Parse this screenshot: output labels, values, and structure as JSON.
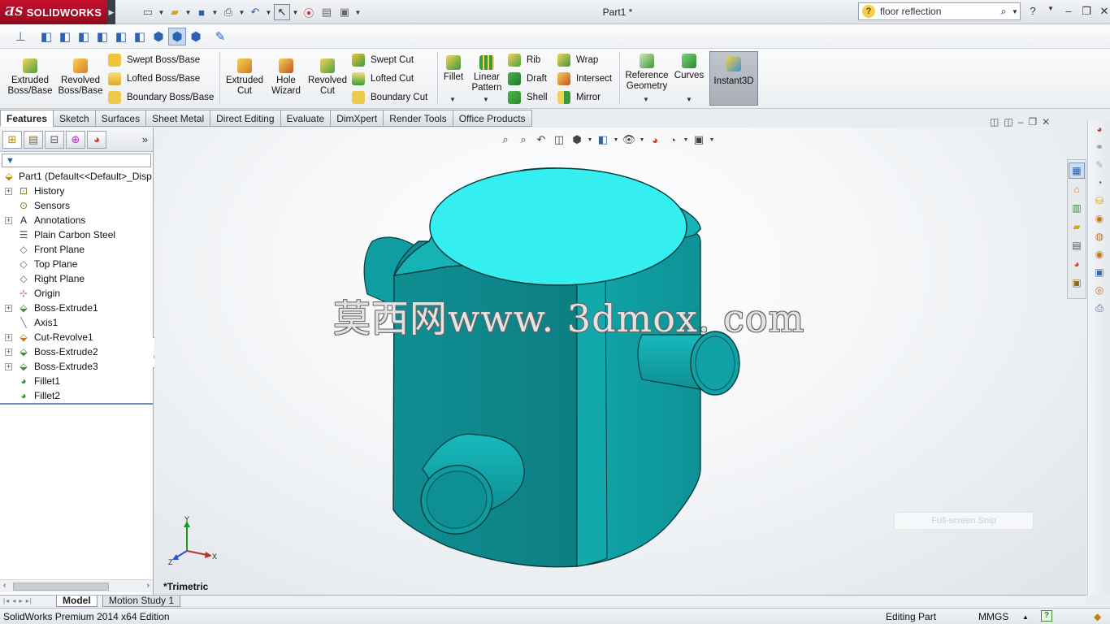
{
  "app": {
    "brand": "SOLIDWORKS",
    "document_title": "Part1 *"
  },
  "search": {
    "value": "floor reflection"
  },
  "ribbon": {
    "extruded_boss": "Extruded Boss/Base",
    "revolved_boss": "Revolved Boss/Base",
    "swept_boss": "Swept Boss/Base",
    "lofted_boss": "Lofted Boss/Base",
    "boundary_boss": "Boundary Boss/Base",
    "extruded_cut": "Extruded Cut",
    "hole_wizard": "Hole Wizard",
    "revolved_cut": "Revolved Cut",
    "swept_cut": "Swept Cut",
    "lofted_cut": "Lofted Cut",
    "boundary_cut": "Boundary Cut",
    "fillet": "Fillet",
    "linear_pattern": "Linear Pattern",
    "rib": "Rib",
    "draft": "Draft",
    "shell": "Shell",
    "wrap": "Wrap",
    "intersect": "Intersect",
    "mirror": "Mirror",
    "reference_geometry": "Reference Geometry",
    "curves": "Curves",
    "instant3d": "Instant3D"
  },
  "tabs": [
    "Features",
    "Sketch",
    "Surfaces",
    "Sheet Metal",
    "Direct Editing",
    "Evaluate",
    "DimXpert",
    "Render Tools",
    "Office Products"
  ],
  "feature_tree": {
    "root": "Part1  (Default<<Default>_Disp",
    "items": [
      {
        "label": "History",
        "icon": "history-icon",
        "expandable": true
      },
      {
        "label": "Sensors",
        "icon": "sensors-icon",
        "expandable": false
      },
      {
        "label": "Annotations",
        "icon": "annotations-icon",
        "expandable": true
      },
      {
        "label": "Plain Carbon Steel",
        "icon": "material-icon",
        "expandable": false
      },
      {
        "label": "Front Plane",
        "icon": "plane-icon",
        "expandable": false
      },
      {
        "label": "Top Plane",
        "icon": "plane-icon",
        "expandable": false
      },
      {
        "label": "Right Plane",
        "icon": "plane-icon",
        "expandable": false
      },
      {
        "label": "Origin",
        "icon": "origin-icon",
        "expandable": false
      },
      {
        "label": "Boss-Extrude1",
        "icon": "boss-extrude-icon",
        "expandable": true
      },
      {
        "label": "Axis1",
        "icon": "axis-icon",
        "expandable": false
      },
      {
        "label": "Cut-Revolve1",
        "icon": "cut-revolve-icon",
        "expandable": true
      },
      {
        "label": "Boss-Extrude2",
        "icon": "boss-extrude-icon",
        "expandable": true
      },
      {
        "label": "Boss-Extrude3",
        "icon": "boss-extrude-icon",
        "expandable": true
      },
      {
        "label": "Fillet1",
        "icon": "fillet-icon",
        "expandable": false
      },
      {
        "label": "Fillet2",
        "icon": "fillet-icon",
        "expandable": false
      }
    ]
  },
  "viewport": {
    "view_orientation": "*Trimetric",
    "watermark": "莫西网www. 3dmox. com",
    "snip_hint": "Full-screen Snip",
    "triad": {
      "x": "X",
      "y": "Y",
      "z": "Z"
    }
  },
  "bottom_tabs": [
    "Model",
    "Motion Study 1"
  ],
  "status": {
    "edition": "SolidWorks Premium 2014 x64 Edition",
    "mode": "Editing Part",
    "units": "MMGS"
  },
  "colors": {
    "model_teal": "#0e9a9e",
    "model_top": "#33f0f0",
    "brand_red": "#c8102e"
  }
}
